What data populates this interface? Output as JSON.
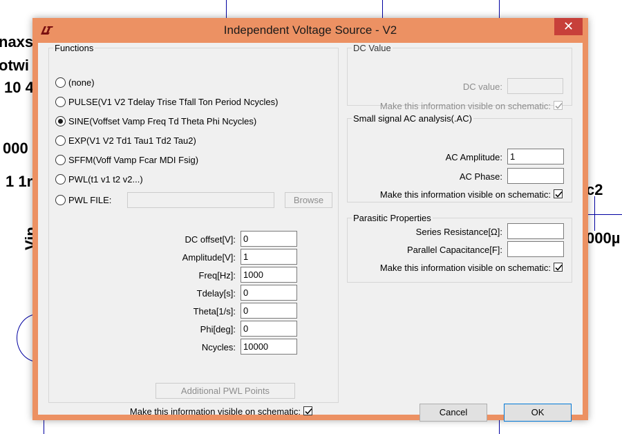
{
  "background": {
    "labels": [
      "naxs",
      "otwi",
      "10 4",
      "000",
      "1 1r",
      "Vin",
      "c2",
      "000µ"
    ]
  },
  "dialog": {
    "title": "Independent Voltage Source - V2",
    "close_glyph": "✕",
    "accent_color": "#ec9163"
  },
  "functions": {
    "legend": "Functions",
    "options": [
      {
        "label": "(none)",
        "selected": false
      },
      {
        "label": "PULSE(V1 V2 Tdelay Trise Tfall Ton Period Ncycles)",
        "selected": false
      },
      {
        "label": "SINE(Voffset Vamp Freq Td Theta Phi Ncycles)",
        "selected": true
      },
      {
        "label": "EXP(V1 V2 Td1 Tau1 Td2 Tau2)",
        "selected": false
      },
      {
        "label": "SFFM(Voff Vamp Fcar MDI Fsig)",
        "selected": false
      },
      {
        "label": "PWL(t1 v1 t2 v2...)",
        "selected": false
      },
      {
        "label": "PWL FILE:",
        "selected": false
      }
    ],
    "pwl_file_value": "",
    "browse_label": "Browse",
    "params": [
      {
        "label": "DC offset[V]:",
        "value": "0"
      },
      {
        "label": "Amplitude[V]:",
        "value": "1"
      },
      {
        "label": "Freq[Hz]:",
        "value": "1000"
      },
      {
        "label": "Tdelay[s]:",
        "value": "0"
      },
      {
        "label": "Theta[1/s]:",
        "value": "0"
      },
      {
        "label": "Phi[deg]:",
        "value": "0"
      },
      {
        "label": "Ncycles:",
        "value": "10000"
      }
    ],
    "additional_pwl_label": "Additional PWL Points",
    "visible_label": "Make this information visible on schematic:",
    "visible_checked": true
  },
  "dc_value": {
    "legend": "DC Value",
    "dc_label": "DC value:",
    "dc_value": "",
    "visible_label": "Make this information visible on schematic:",
    "visible_checked": true
  },
  "ac": {
    "legend": "Small signal AC analysis(.AC)",
    "amplitude_label": "AC Amplitude:",
    "amplitude_value": "1",
    "phase_label": "AC Phase:",
    "phase_value": "",
    "visible_label": "Make this information visible on schematic:",
    "visible_checked": true
  },
  "parasitic": {
    "legend": "Parasitic Properties",
    "series_label": "Series Resistance[Ω]:",
    "series_value": "",
    "parallel_label": "Parallel Capacitance[F]:",
    "parallel_value": "",
    "visible_label": "Make this information visible on schematic:",
    "visible_checked": true
  },
  "buttons": {
    "cancel": "Cancel",
    "ok": "OK"
  }
}
